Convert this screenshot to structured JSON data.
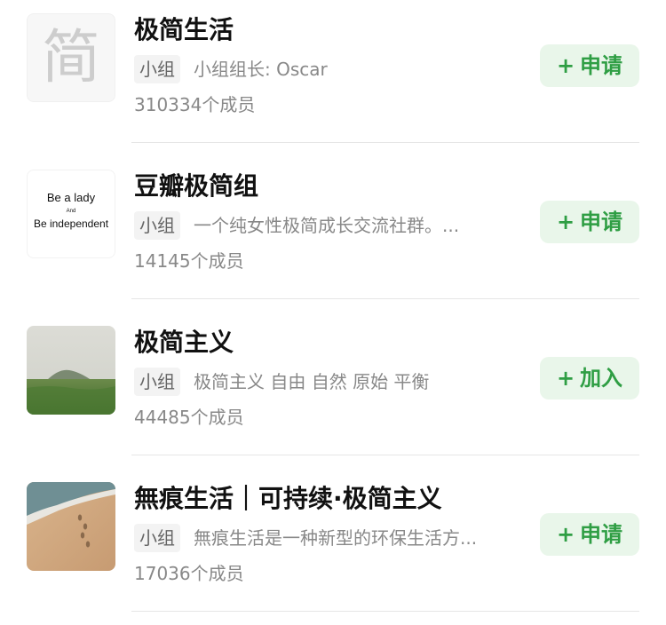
{
  "groups": [
    {
      "thumb_char": "简",
      "title": "极简生活",
      "tag": "小组",
      "desc": "小组组长: Oscar",
      "members": "310334个成员",
      "action": "申请",
      "plus": "+"
    },
    {
      "thumb_lines": [
        "Be a lady",
        "And",
        "Be independent"
      ],
      "title": "豆瓣极简组",
      "tag": "小组",
      "desc": "一个纯女性极简成长交流社群。...",
      "members": "14145个成员",
      "action": "申请",
      "plus": "+"
    },
    {
      "title": "极简主义",
      "tag": "小组",
      "desc": "极简主义 自由 自然 原始 平衡",
      "members": "44485个成员",
      "action": "加入",
      "plus": "+"
    },
    {
      "title": "無痕生活｜可持续·极简主义",
      "tag": "小组",
      "desc": "無痕生活是一种新型的环保生活方...",
      "members": "17036个成员",
      "action": "申请",
      "plus": "+"
    }
  ],
  "colors": {
    "action_text": "#2f9e44",
    "action_bg": "#e9f6ea",
    "secondary_text": "#888888",
    "tag_bg": "#f3f3f3"
  }
}
